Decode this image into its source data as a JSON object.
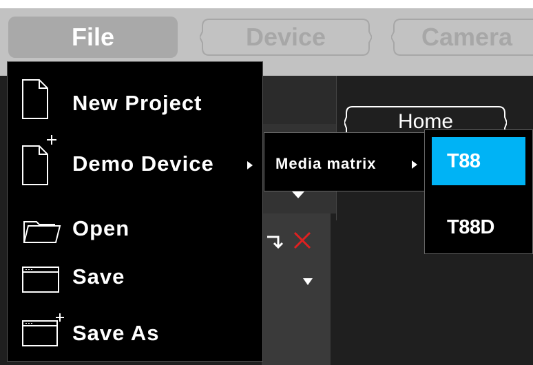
{
  "menubar": {
    "tabs": [
      {
        "label": "File"
      },
      {
        "label": "Device"
      },
      {
        "label": "Camera"
      }
    ]
  },
  "home": {
    "label": "Home"
  },
  "file_menu": {
    "items": [
      {
        "label": "New Project",
        "icon": "new-file-icon"
      },
      {
        "label": "Demo Device",
        "icon": "new-file-plus-icon",
        "has_submenu": true
      },
      {
        "label": "Open",
        "icon": "folder-icon"
      },
      {
        "label": "Save",
        "icon": "window-icon"
      },
      {
        "label": "Save As",
        "icon": "window-plus-icon"
      }
    ]
  },
  "submenu": {
    "label": "Media matrix",
    "options": [
      {
        "label": "T88",
        "selected": true
      },
      {
        "label": "T88D",
        "selected": false
      }
    ]
  },
  "colors": {
    "highlight": "#00b3f5",
    "close": "#e02020"
  }
}
